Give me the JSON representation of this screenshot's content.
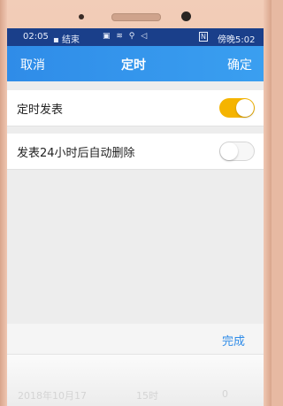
{
  "status_bar": {
    "time": "02:05",
    "app_tag": "▪ 结束",
    "icons": "▣ ≋ ⚲ ◁",
    "nfc": "N",
    "right_text": "傍晚5:02"
  },
  "app_bar": {
    "cancel_label": "取消",
    "title": "定时",
    "confirm_label": "确定",
    "accent_color": "#2f8ce8"
  },
  "settings": {
    "scheduled_post": {
      "label": "定时发表",
      "enabled": true,
      "toggle_color": "#f5b400"
    },
    "auto_delete": {
      "label": "发表24小时后自动删除",
      "enabled": false
    }
  },
  "picker": {
    "done_label": "完成",
    "date_value": "2018年10月17",
    "hour_value": "15时",
    "minute_value": "0"
  }
}
